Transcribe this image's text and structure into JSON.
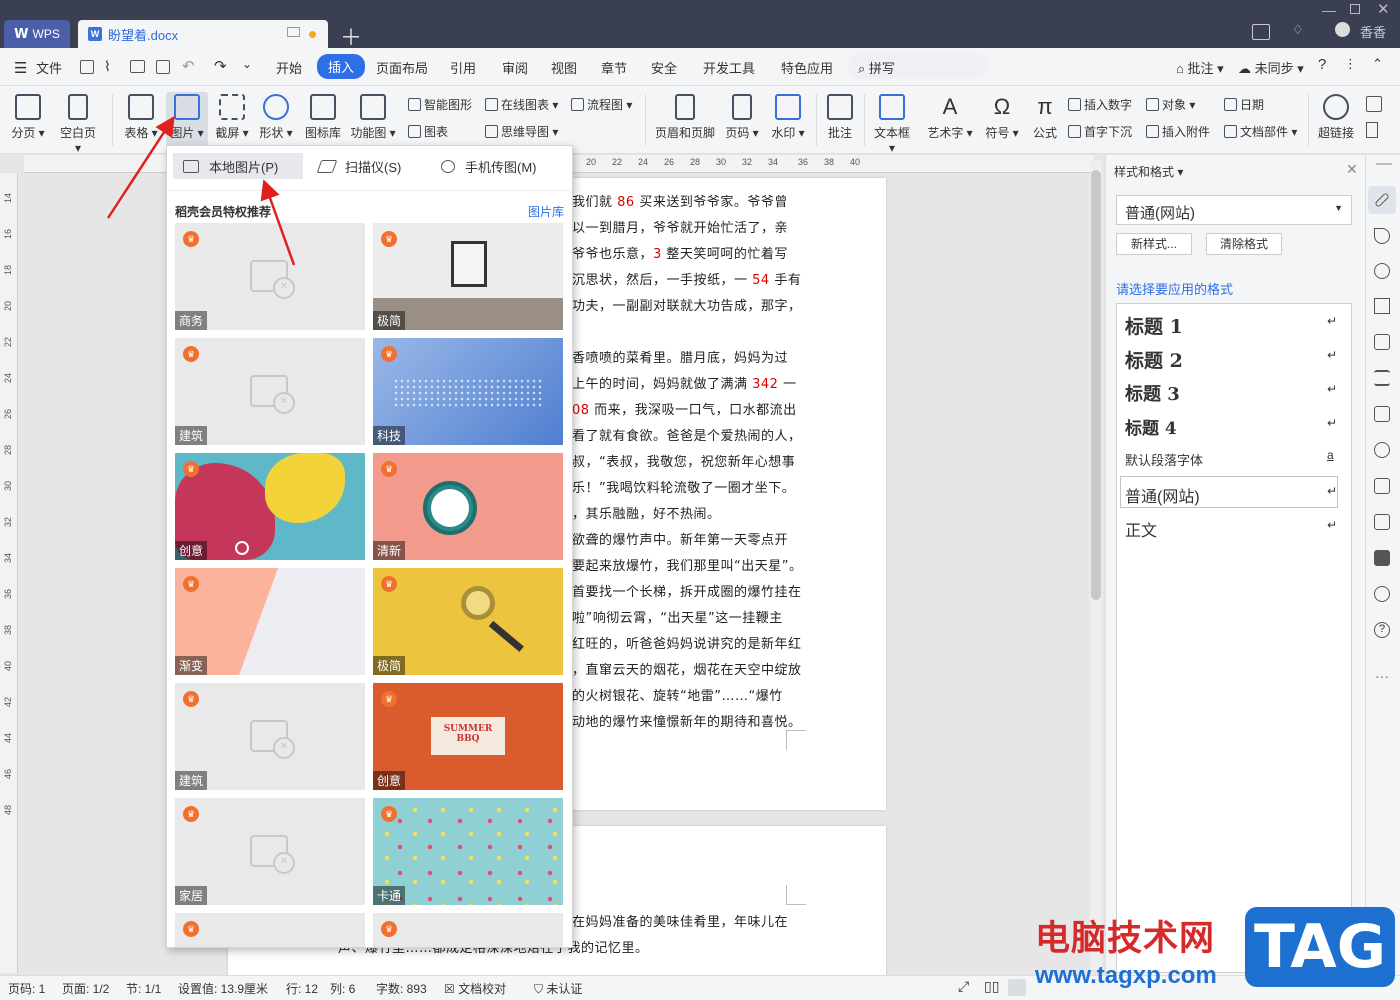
{
  "titlebar": {
    "app_tab": "WPS",
    "doc_tab": "盼望着.docx",
    "user": "香香"
  },
  "menubar": {
    "file": "文件",
    "tabs": [
      "开始",
      "插入",
      "页面布局",
      "引用",
      "审阅",
      "视图",
      "章节",
      "安全",
      "开发工具",
      "特色应用"
    ],
    "active_tab": "插入",
    "search": "拼写",
    "right": [
      "批注",
      "未同步"
    ]
  },
  "ribbon": {
    "big_buttons": [
      "分页",
      "空白页",
      "表格",
      "图片",
      "截屏",
      "形状",
      "图标库",
      "功能图",
      "页眉和页脚",
      "页码",
      "水印",
      "批注",
      "文本框",
      "艺术字",
      "符号",
      "公式",
      "超链接"
    ],
    "small_buttons": [
      "智能图形",
      "在线图表",
      "流程图",
      "图表",
      "思维导图",
      "插入数字",
      "对象",
      "日期",
      "首字下沉",
      "插入附件",
      "文档部件"
    ]
  },
  "ruler": {
    "top_ticks": [
      "20",
      "22",
      "24",
      "26",
      "28",
      "30",
      "32",
      "34",
      "36",
      "38",
      "40"
    ],
    "left_ticks": [
      "14",
      "16",
      "18",
      "20",
      "22",
      "24",
      "26",
      "28",
      "30",
      "32",
      "34",
      "36",
      "38",
      "40",
      "42",
      "44",
      "46",
      "48"
    ]
  },
  "document": {
    "page1_lines": [
      [
        "我们就 ",
        "86",
        " 买来送到爷爷家。爷爷曾"
      ],
      [
        "以一到腊月，爷爷就开始忙活了，亲"
      ],
      [
        "爷爷也乐意，",
        "3",
        " 整天笑呵呵的忙着写"
      ],
      [
        "沉思状，然后，一手按纸，一 ",
        "54",
        " 手有"
      ],
      [
        "功夫，一副副对联就大功告成，那字，"
      ],
      [
        ""
      ],
      [
        "香喷喷的菜肴里。腊月底，妈妈为过"
      ],
      [
        "上午的时间，妈妈就做了满满 ",
        "342",
        " 一"
      ],
      [
        "08",
        " 而来，我深吸一口气，口水都流出"
      ],
      [
        "看了就有食欲。爸爸是个爱热闹的人，"
      ],
      [
        "叔，“表叔，我敬您，祝您新年心想事"
      ],
      [
        "乐！”我喝饮料轮流敬了一圈才坐下。"
      ],
      [
        "，其乐融融，好不热闹。"
      ],
      [
        "欲聋的爆竹声中。新年第一天零点开"
      ],
      [
        "要起来放爆竹，我们那里叫“出天星”。"
      ],
      [
        "首要找一个长梯，拆开成圈的爆竹挂在"
      ],
      [
        "啦”响彻云霄，“出天星”这一挂鞭主"
      ],
      [
        "红旺的，听爸爸妈妈说讲究的是新年红"
      ],
      [
        "，直窜云天的烟花，烟花在天空中绽放"
      ],
      [
        "的火树银花、旋转“地雷”……“爆竹"
      ],
      [
        "动地的爆竹来憧憬新年的期待和喜悦。"
      ]
    ],
    "page2_lines": [
      "在妈妈准备的美味佳肴里，年味儿在",
      "声、爆竹里……都成定格深深地烙在了我的记忆里。"
    ]
  },
  "picture_dropdown": {
    "options": [
      "本地图片(P)",
      "扫描仪(S)",
      "手机传图(M)"
    ],
    "section_title": "稻壳会员特权推荐",
    "library_link": "图片库",
    "thumbnails": [
      {
        "label": "商务",
        "kind": "placeholder"
      },
      {
        "label": "极简",
        "kind": "frame"
      },
      {
        "label": "建筑",
        "kind": "placeholder"
      },
      {
        "label": "科技",
        "kind": "tech"
      },
      {
        "label": "创意",
        "kind": "creative"
      },
      {
        "label": "清新",
        "kind": "clock"
      },
      {
        "label": "渐变",
        "kind": "gradient"
      },
      {
        "label": "极简",
        "kind": "magnifier"
      },
      {
        "label": "建筑",
        "kind": "placeholder"
      },
      {
        "label": "创意",
        "kind": "bbq"
      },
      {
        "label": "家居",
        "kind": "placeholder"
      },
      {
        "label": "卡通",
        "kind": "cartoon"
      }
    ],
    "bbq_text": "SUMMER BBQ"
  },
  "style_panel": {
    "title": "样式和格式",
    "current": "普通(网站)",
    "new_style": "新样式...",
    "clear_format": "清除格式",
    "prompt": "请选择要应用的格式",
    "styles": [
      "标题 1",
      "标题 2",
      "标题 3",
      "标题 4",
      "默认段落字体",
      "普通(网站)",
      "正文"
    ]
  },
  "statusbar": {
    "page_code": "页码: 1",
    "page": "页面: 1/2",
    "section": "节: 1/1",
    "setting": "设置值: 13.9厘米",
    "row": "行: 12",
    "col": "列: 6",
    "words": "字数: 893",
    "proof": "文档校对",
    "cert": "未认证"
  },
  "watermark": {
    "text": "电脑技术网",
    "url": "www.tagxp.com",
    "tag": "TAG"
  },
  "colors": {
    "accent": "#2e6ee6",
    "titlebar": "#3b3f52",
    "arrow": "#e02020",
    "brand_red": "#d42a2a",
    "brand_blue": "#1d6fd0"
  }
}
